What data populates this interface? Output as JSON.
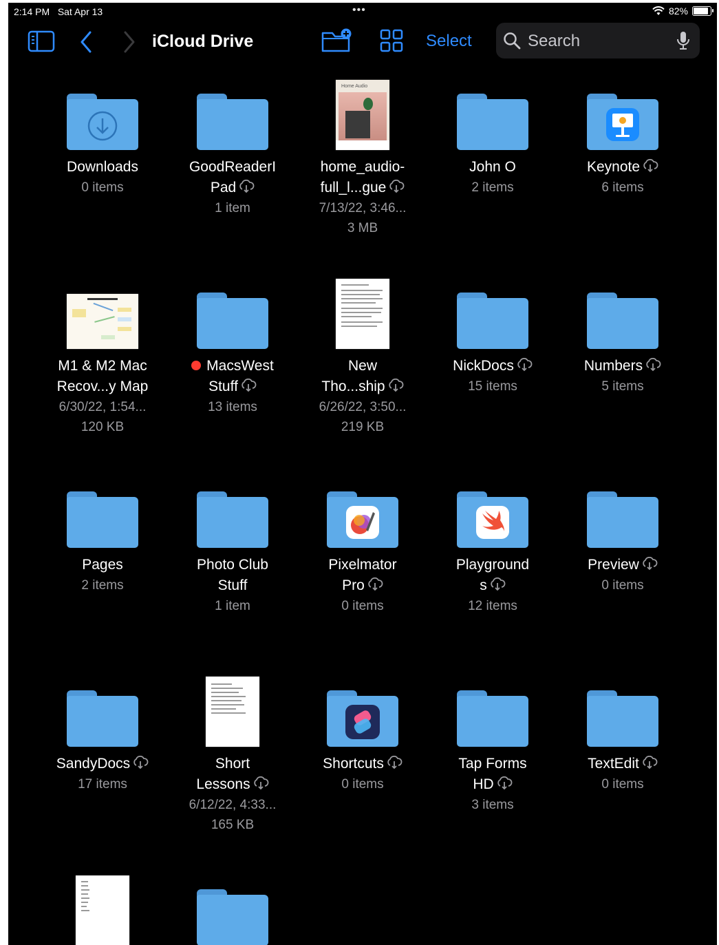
{
  "status": {
    "time": "2:14 PM",
    "date": "Sat Apr 13",
    "battery": "82%",
    "battery_level": 0.82
  },
  "toolbar": {
    "title": "iCloud Drive",
    "select_label": "Select",
    "search_placeholder": "Search"
  },
  "colors": {
    "accent": "#2f8bff",
    "folder": "#5eabe9",
    "background": "#000000"
  },
  "items": [
    {
      "name": "Downloads",
      "meta": [
        "0 items"
      ]
    },
    {
      "name": "GoodReaderI",
      "name2": "Pad",
      "meta": [
        "1 item"
      ]
    },
    {
      "name": "home_audio-",
      "name2": "full_l...gue",
      "meta": [
        "7/13/22, 3:46...",
        "3 MB"
      ]
    },
    {
      "name": "John O",
      "meta": [
        "2 items"
      ]
    },
    {
      "name": "Keynote",
      "meta": [
        "6 items"
      ]
    },
    {
      "name": "M1 & M2 Mac",
      "name2": "Recov...y Map",
      "meta": [
        "6/30/22, 1:54...",
        "120 KB"
      ]
    },
    {
      "name": "MacsWest",
      "name2": "Stuff",
      "meta": [
        "13 items"
      ]
    },
    {
      "name": "New",
      "name2": "Tho...ship",
      "meta": [
        "6/26/22, 3:50...",
        "219 KB"
      ]
    },
    {
      "name": "NickDocs",
      "meta": [
        "15 items"
      ]
    },
    {
      "name": "Numbers",
      "meta": [
        "5 items"
      ]
    },
    {
      "name": "Pages",
      "meta": [
        "2 items"
      ]
    },
    {
      "name": "Photo Club",
      "name2": "Stuff",
      "meta": [
        "1 item"
      ]
    },
    {
      "name": "Pixelmator",
      "name2": "Pro",
      "meta": [
        "0 items"
      ]
    },
    {
      "name": "Playground",
      "name2": "s",
      "meta": [
        "12 items"
      ]
    },
    {
      "name": "Preview",
      "meta": [
        "0 items"
      ]
    },
    {
      "name": "SandyDocs",
      "meta": [
        "17 items"
      ]
    },
    {
      "name": "Short",
      "name2": "Lessons",
      "meta": [
        "6/12/22, 4:33...",
        "165 KB"
      ]
    },
    {
      "name": "Shortcuts",
      "meta": [
        "0 items"
      ]
    },
    {
      "name": "Tap Forms",
      "name2": "HD",
      "meta": [
        "3 items"
      ]
    },
    {
      "name": "TextEdit",
      "meta": [
        "0 items"
      ]
    }
  ],
  "thumbnail_text": {
    "home_audio": "Home Audio"
  }
}
